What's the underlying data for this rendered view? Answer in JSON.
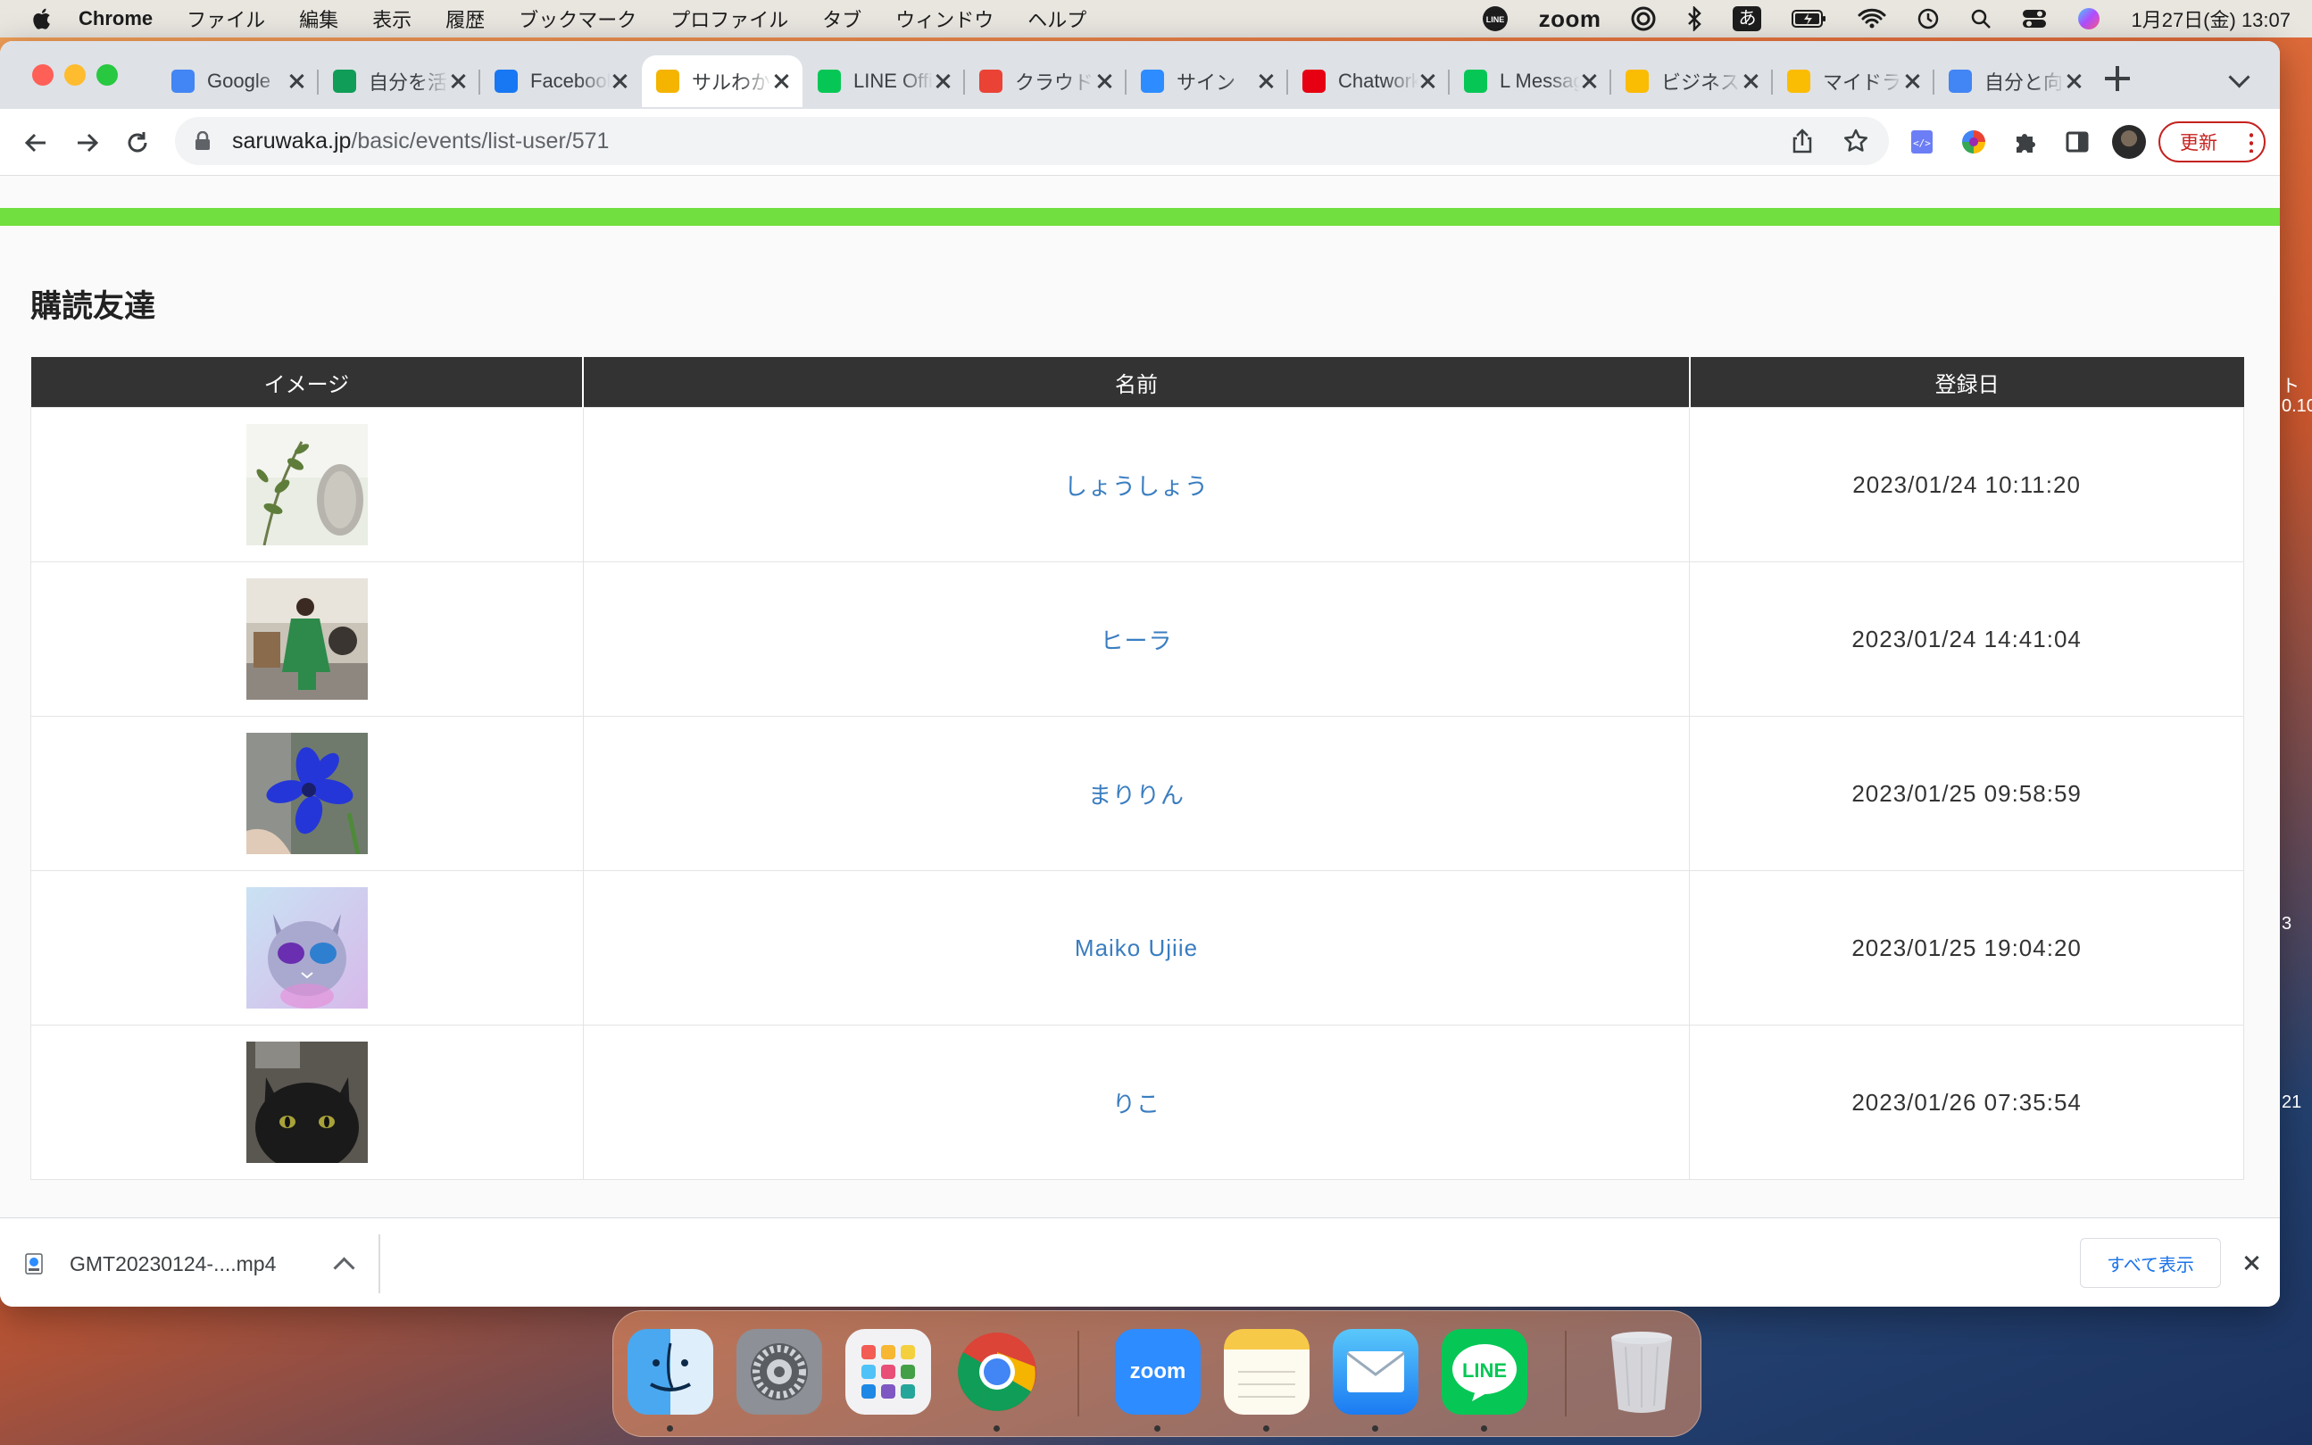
{
  "menubar": {
    "app_name": "Chrome",
    "menus": [
      "ファイル",
      "編集",
      "表示",
      "履歴",
      "ブックマーク",
      "プロファイル",
      "タブ",
      "ウィンドウ",
      "ヘルプ"
    ],
    "zoom_label": "zoom",
    "input_mode": "あ",
    "clock": "1月27日(金)  13:07"
  },
  "tabs": [
    {
      "title": "Google",
      "favicon": "google-icon",
      "color": "#4285f4"
    },
    {
      "title": "自分を活",
      "favicon": "sheets-icon",
      "color": "#0f9d58"
    },
    {
      "title": "Facebook",
      "favicon": "facebook-icon",
      "color": "#1877f2"
    },
    {
      "title": "サルわか",
      "favicon": "saruwaka-icon",
      "color": "#f4b400"
    },
    {
      "title": "LINE Official",
      "favicon": "line-official-icon",
      "color": "#06c755"
    },
    {
      "title": "クラウド",
      "favicon": "gmail-icon",
      "color": "#ea4335"
    },
    {
      "title": "サイン",
      "favicon": "zoom-sign-icon",
      "color": "#2d8cff"
    },
    {
      "title": "Chatwork",
      "favicon": "chatwork-icon",
      "color": "#e60012"
    },
    {
      "title": "L Message",
      "favicon": "lmessage-icon",
      "color": "#06c755"
    },
    {
      "title": "ビジネス",
      "favicon": "drive-icon",
      "color": "#fbbc04"
    },
    {
      "title": "マイドライブ",
      "favicon": "drive-icon",
      "color": "#fbbc04"
    },
    {
      "title": "自分と向",
      "favicon": "docs-icon",
      "color": "#4285f4"
    }
  ],
  "active_tab_index": 3,
  "address": {
    "host": "saruwaka.jp",
    "path": "/basic/events/list-user/571"
  },
  "update_label": "更新",
  "page": {
    "title": "購読友達",
    "columns": [
      "イメージ",
      "名前",
      "登録日"
    ],
    "rows": [
      {
        "image": "plant-photo",
        "name": "しょうしょう",
        "date": "2023/01/24 10:11:20"
      },
      {
        "image": "person-green-dress-photo",
        "name": "ヒーラ",
        "date": "2023/01/24 14:41:04"
      },
      {
        "image": "blue-flower-photo",
        "name": "まりりん",
        "date": "2023/01/25 09:58:59"
      },
      {
        "image": "cat-sunglasses-photo",
        "name": "Maiko Ujiie",
        "date": "2023/01/25 19:04:20"
      },
      {
        "image": "black-cat-photo",
        "name": "りこ",
        "date": "2023/01/26 07:35:54"
      }
    ]
  },
  "download": {
    "filename": "GMT20230124-....mp4",
    "show_all": "すべて表示"
  },
  "desktop_fragments": [
    "ト",
    "0.10",
    "3",
    "21"
  ],
  "dock": [
    {
      "name": "finder",
      "dot": true
    },
    {
      "name": "system-settings",
      "dot": false
    },
    {
      "name": "launchpad",
      "dot": false
    },
    {
      "name": "chrome",
      "dot": true
    },
    {
      "name": "zoom",
      "label": "zoom",
      "dot": true
    },
    {
      "name": "notes",
      "dot": true
    },
    {
      "name": "mail",
      "dot": true
    },
    {
      "name": "line",
      "label": "LINE",
      "dot": true
    },
    {
      "name": "trash",
      "dot": false
    }
  ],
  "colors": {
    "accent_green": "#71df3f",
    "link_blue": "#3a7dc0",
    "header_dark": "#333333",
    "update_red": "#c5221f"
  }
}
